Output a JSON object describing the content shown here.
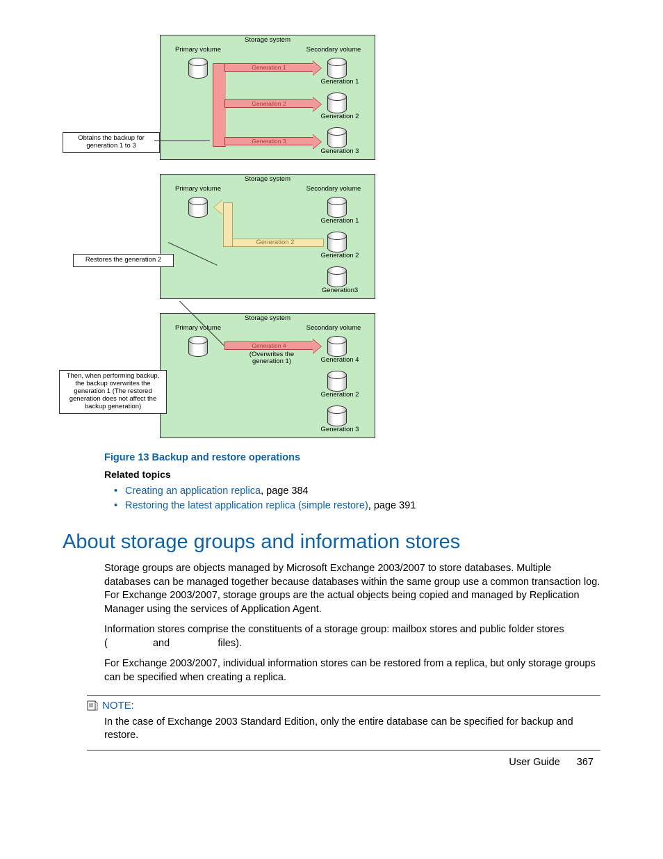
{
  "diagrams": {
    "d1": {
      "system": "Storage system",
      "primary": "Primary volume",
      "secondary": "Secondary volume",
      "gen1": "Generation 1",
      "gen2": "Generation 2",
      "gen3": "Generation 3",
      "callout": "Obtains the backup for generation 1 to 3"
    },
    "d2": {
      "system": "Storage system",
      "primary": "Primary volume",
      "secondary": "Secondary volume",
      "gen1": "Generation 1",
      "gen2": "Generation 2",
      "gen3": "Generation3",
      "callout": "Restores the generation 2"
    },
    "d3": {
      "system": "Storage system",
      "primary": "Primary volume",
      "secondary": "Secondary volume",
      "gen4a": "Generation 4",
      "overwrite": "(Overwrites the generation 1)",
      "gen4b": "Generation 4",
      "gen2": "Generation 2",
      "gen3": "Generation 3",
      "callout": "Then, when performing backup, the backup overwrites the generation 1 (The restored generation does not affect the backup generation)"
    }
  },
  "figure_caption": "Figure 13 Backup and restore operations",
  "related_label": "Related topics",
  "related": [
    {
      "link": "Creating an application replica",
      "suffix": ", page 384"
    },
    {
      "link": "Restoring the latest application replica (simple restore)",
      "suffix": ", page 391"
    }
  ],
  "heading": "About storage groups and information stores",
  "para1": "Storage groups are objects managed by Microsoft Exchange 2003/2007 to store databases. Multiple databases can be managed together because databases within the same group use a common transaction log. For Exchange 2003/2007, storage groups are the actual objects being copied and managed by Replication Manager using the services of Application Agent.",
  "para2_a": "Information stores comprise the constituents of a storage group: mailbox stores and public folder stores (",
  "para2_b": " and ",
  "para2_c": " files).",
  "para3": "For Exchange 2003/2007, individual information stores can be restored from a replica, but only storage groups can be specified when creating a replica.",
  "note_label": "NOTE:",
  "note_body": "In the case of Exchange 2003 Standard Edition, only the entire database can be specified for backup and restore.",
  "footer_text": "User Guide",
  "page_number": "367"
}
